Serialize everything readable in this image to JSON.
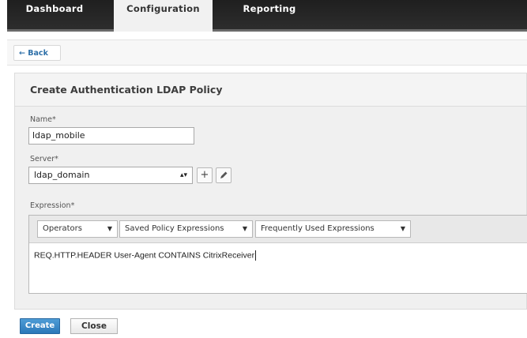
{
  "nav": {
    "tabs": [
      {
        "label": "Dashboard"
      },
      {
        "label": "Configuration"
      },
      {
        "label": "Reporting"
      }
    ],
    "active_tab": "Configuration"
  },
  "back": {
    "label": "Back"
  },
  "form": {
    "title": "Create Authentication LDAP Policy",
    "name_label": "Name*",
    "name_value": "ldap_mobile",
    "server_label": "Server*",
    "server_value": "ldap_domain",
    "expression_label": "Expression*",
    "expression_value": "REQ.HTTP.HEADER User-Agent CONTAINS CitrixReceiver",
    "dropdowns": [
      {
        "label": "Operators"
      },
      {
        "label": "Saved Policy Expressions"
      },
      {
        "label": "Frequently Used Expressions"
      }
    ]
  },
  "buttons": {
    "create": "Create",
    "close": "Close"
  },
  "icons": {
    "back": "arrow-left-icon",
    "add": "plus-icon",
    "edit": "pencil-icon",
    "dropdown": "chevron-down-icon"
  },
  "colors": {
    "primary": "#2b78b9",
    "nav_bg": "#1f1f1f"
  }
}
